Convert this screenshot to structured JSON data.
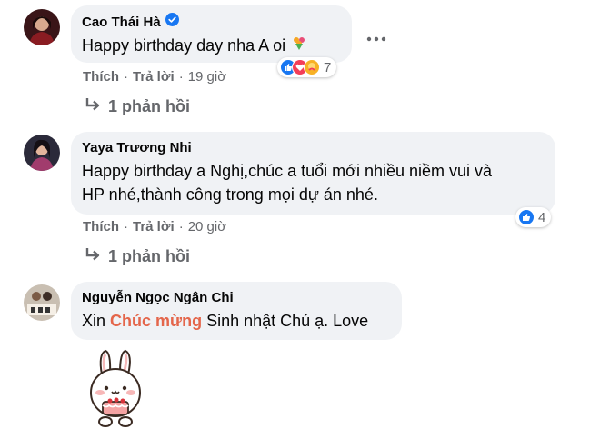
{
  "comments": [
    {
      "author": "Cao Thái Hà",
      "verified": true,
      "text": "Happy birthday day nha A oi",
      "actions": {
        "like": "Thích",
        "reply": "Trả lời",
        "time": "19 giờ"
      },
      "reaction_icons": [
        "like-icon",
        "love-icon",
        "care-icon"
      ],
      "reaction_count": "7",
      "replies": "1 phản hồi"
    },
    {
      "author": "Yaya Trương Nhi",
      "text_line1": "Happy birthday a Nghị,chúc a tuổi mới nhiều niềm vui và",
      "text_line2": "HP nhé,thành công trong mọi dự án nhé.",
      "actions": {
        "like": "Thích",
        "reply": "Trả lời",
        "time": "20 giờ"
      },
      "reaction_icons": [
        "like-icon"
      ],
      "reaction_count": "4",
      "replies": "1 phản hồi"
    },
    {
      "author": "Nguyễn Ngọc Ngân Chi",
      "text_before": "Xin ",
      "text_highlight": "Chúc mừng",
      "text_after": " Sinh nhật Chú ạ. Love",
      "sticker": "bunny-cake-sticker"
    }
  ],
  "colors": {
    "bubble": "#f0f2f5",
    "secondary_text": "#65676b",
    "like_blue": "#1877f2",
    "love_red": "#f33e58",
    "highlight": "#e4664b"
  }
}
